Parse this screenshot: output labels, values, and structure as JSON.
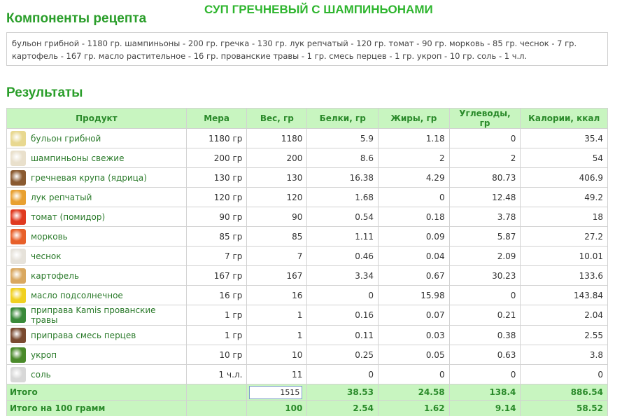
{
  "page_title": "СУП ГРЕЧНЕВЫЙ С ШАМПИНЬОНАМИ",
  "components_title": "Компоненты рецепта",
  "ingredients_text": "бульон грибной - 1180 гр. шампиньоны - 200 гр. гречка - 130 гр. лук репчатый - 120 гр. томат - 90 гр. морковь - 85 гр. чеснок - 7 гр. картофель - 167 гр. масло растительное - 16 гр. прованские травы - 1 гр. смесь перцев - 1 гр. укроп - 10 гр. соль - 1 ч.л.",
  "results_title": "Результаты",
  "table": {
    "headers": {
      "product": "Продукт",
      "measure": "Мера",
      "weight": "Вес, гр",
      "protein": "Белки, гр",
      "fat": "Жиры, гр",
      "carbs": "Углеводы, гр",
      "calories": "Калории, ккал"
    },
    "rows": [
      {
        "icon": "broth-icon",
        "color": "#e8d890",
        "name": "бульон грибной",
        "measure": "1180 гр",
        "weight": "1180",
        "protein": "5.9",
        "fat": "1.18",
        "carbs": "0",
        "calories": "35.4"
      },
      {
        "icon": "mushroom-icon",
        "color": "#e9e0cc",
        "name": "шампиньоны свежие",
        "measure": "200 гр",
        "weight": "200",
        "protein": "8.6",
        "fat": "2",
        "carbs": "2",
        "calories": "54"
      },
      {
        "icon": "buckwheat-icon",
        "color": "#8a5a30",
        "name": "гречневая крупа (ядрица)",
        "measure": "130 гр",
        "weight": "130",
        "protein": "16.38",
        "fat": "4.29",
        "carbs": "80.73",
        "calories": "406.9"
      },
      {
        "icon": "onion-icon",
        "color": "#e8a030",
        "name": "лук репчатый",
        "measure": "120 гр",
        "weight": "120",
        "protein": "1.68",
        "fat": "0",
        "carbs": "12.48",
        "calories": "49.2"
      },
      {
        "icon": "tomato-icon",
        "color": "#e03a20",
        "name": "томат (помидор)",
        "measure": "90 гр",
        "weight": "90",
        "protein": "0.54",
        "fat": "0.18",
        "carbs": "3.78",
        "calories": "18"
      },
      {
        "icon": "carrot-icon",
        "color": "#e8602a",
        "name": "морковь",
        "measure": "85 гр",
        "weight": "85",
        "protein": "1.11",
        "fat": "0.09",
        "carbs": "5.87",
        "calories": "27.2"
      },
      {
        "icon": "garlic-icon",
        "color": "#e6e2da",
        "name": "чеснок",
        "measure": "7 гр",
        "weight": "7",
        "protein": "0.46",
        "fat": "0.04",
        "carbs": "2.09",
        "calories": "10.01"
      },
      {
        "icon": "potato-icon",
        "color": "#d9a860",
        "name": "картофель",
        "measure": "167 гр",
        "weight": "167",
        "protein": "3.34",
        "fat": "0.67",
        "carbs": "30.23",
        "calories": "133.6"
      },
      {
        "icon": "oil-icon",
        "color": "#f0d020",
        "name": "масло подсолнечное",
        "measure": "16 гр",
        "weight": "16",
        "protein": "0",
        "fat": "15.98",
        "carbs": "0",
        "calories": "143.84"
      },
      {
        "icon": "herbs-pack-icon",
        "color": "#3a8a3a",
        "name": "приправа Kamis прованские травы",
        "measure": "1 гр",
        "weight": "1",
        "protein": "0.16",
        "fat": "0.07",
        "carbs": "0.21",
        "calories": "2.04"
      },
      {
        "icon": "pepper-mix-icon",
        "color": "#7a4a30",
        "name": "приправа смесь перцев",
        "measure": "1 гр",
        "weight": "1",
        "protein": "0.11",
        "fat": "0.03",
        "carbs": "0.38",
        "calories": "2.55"
      },
      {
        "icon": "dill-icon",
        "color": "#4a8a2a",
        "name": "укроп",
        "measure": "10 гр",
        "weight": "10",
        "protein": "0.25",
        "fat": "0.05",
        "carbs": "0.63",
        "calories": "3.8"
      },
      {
        "icon": "salt-icon",
        "color": "#d8d8d8",
        "name": "соль",
        "measure": "1 ч.л.",
        "weight": "11",
        "protein": "0",
        "fat": "0",
        "carbs": "0",
        "calories": "0"
      }
    ],
    "total": {
      "label": "Итого",
      "weight_input": "1515",
      "protein": "38.53",
      "fat": "24.58",
      "carbs": "138.4",
      "calories": "886.54"
    },
    "per100": {
      "label": "Итого на 100 грамм",
      "weight": "100",
      "protein": "2.54",
      "fat": "1.62",
      "carbs": "9.14",
      "calories": "58.52"
    }
  }
}
